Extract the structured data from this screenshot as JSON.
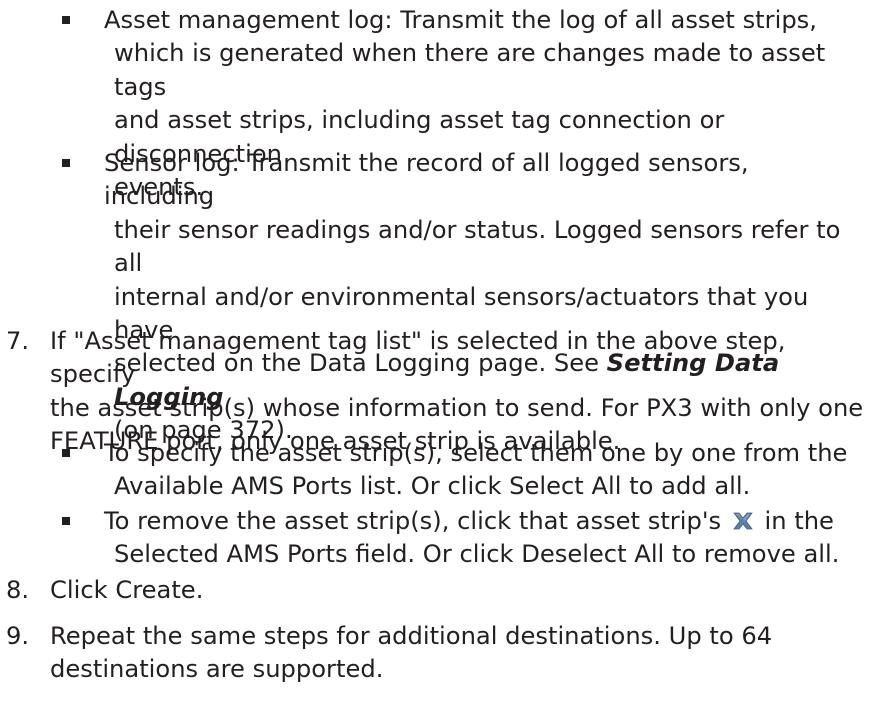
{
  "bullets_top": [
    {
      "lines": [
        "Asset management log: Transmit the log of all asset strips,",
        "which is generated when there are changes made to asset tags",
        "and asset strips, including asset tag connection or disconnection",
        "events."
      ]
    },
    {
      "lines_before_link": [
        "Sensor log: Transmit the record of all logged sensors, including",
        "their sensor readings and/or status. Logged sensors refer to all",
        "internal and/or environmental sensors/actuators that you have"
      ],
      "last_line_prefix": "selected on the Data Logging page. See ",
      "link_text": "Setting Data Logging",
      "page_ref": "(on page 372)."
    }
  ],
  "step7": {
    "number": "7.",
    "lines": [
      "If \"Asset management tag list\" is selected in the above step, specify",
      "the asset strip(s) whose information to send. For PX3 with only one",
      "FEATURE port, only one asset strip is available."
    ],
    "bullets": [
      {
        "lines": [
          "To specify the asset strip(s), select them one by one from the",
          "Available AMS Ports list. Or click Select All to add all."
        ]
      },
      {
        "line1_before_icon": "To remove the asset strip(s), click that asset strip's",
        "icon": "remove-x-icon",
        "line1_after_icon": "in the",
        "line2": "Selected AMS Ports field. Or click Deselect All to remove all."
      }
    ]
  },
  "step8": {
    "number": "8.",
    "text": "Click Create."
  },
  "step9": {
    "number": "9.",
    "lines": [
      "Repeat the same steps for additional destinations. Up to 64",
      "destinations are supported."
    ]
  },
  "colors": {
    "text": "#231f20",
    "icon_x": "#5a7fa8"
  }
}
